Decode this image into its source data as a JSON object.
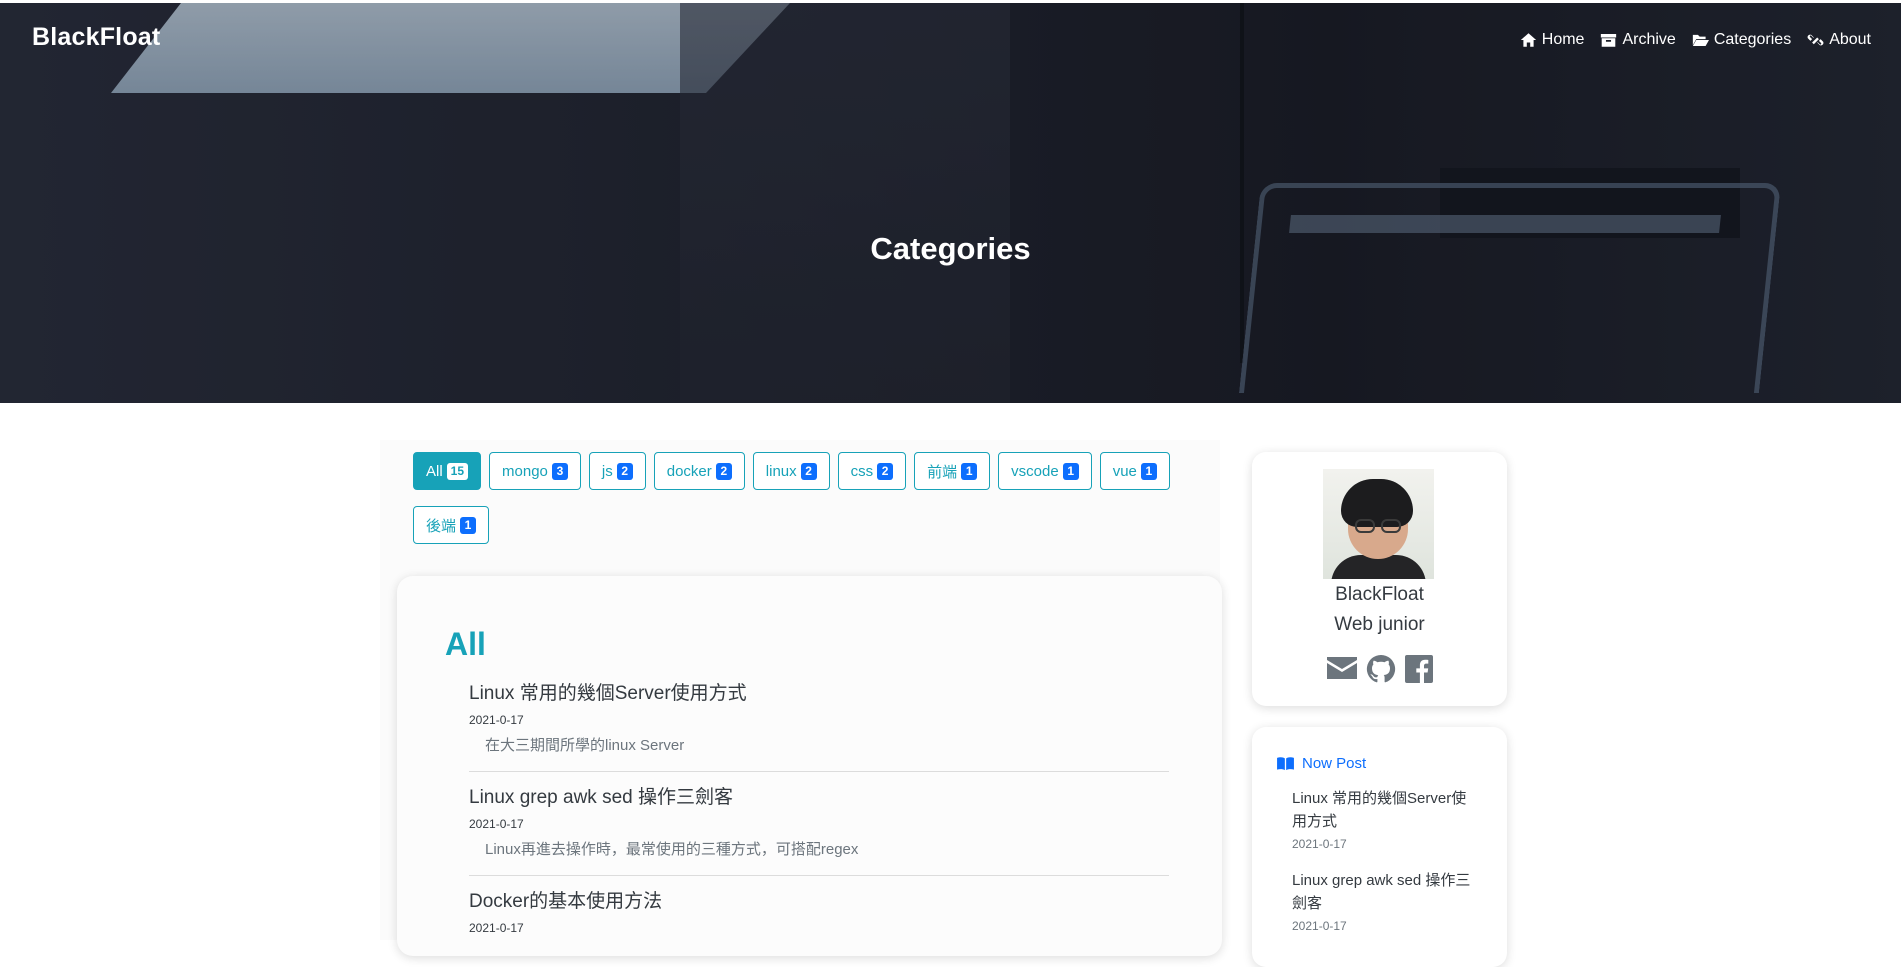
{
  "site": {
    "brand": "BlackFloat",
    "nav": [
      {
        "label": "Home",
        "icon": "home-icon"
      },
      {
        "label": "Archive",
        "icon": "archive-icon"
      },
      {
        "label": "Categories",
        "icon": "folder-open-icon"
      },
      {
        "label": "About",
        "icon": "link-icon"
      }
    ]
  },
  "hero": {
    "title": "Categories"
  },
  "categories": [
    {
      "label": "All",
      "count": "15",
      "active": true
    },
    {
      "label": "mongo",
      "count": "3"
    },
    {
      "label": "js",
      "count": "2"
    },
    {
      "label": "docker",
      "count": "2"
    },
    {
      "label": "linux",
      "count": "2"
    },
    {
      "label": "css",
      "count": "2"
    },
    {
      "label": "前端",
      "count": "1"
    },
    {
      "label": "vscode",
      "count": "1"
    },
    {
      "label": "vue",
      "count": "1"
    },
    {
      "label": "後端",
      "count": "1"
    }
  ],
  "main": {
    "section_title": "All",
    "posts": [
      {
        "title": "Linux 常用的幾個Server使用方式",
        "date": "2021-0-17",
        "desc": "在大三期間所學的linux Server"
      },
      {
        "title": "Linux grep awk sed 操作三劍客",
        "date": "2021-0-17",
        "desc": "Linux再進去操作時，最常使用的三種方式，可搭配regex"
      },
      {
        "title": "Docker的基本使用方法",
        "date": "2021-0-17",
        "desc": ""
      }
    ]
  },
  "profile": {
    "name": "BlackFloat",
    "role": "Web junior",
    "social": [
      "envelope-icon",
      "github-icon",
      "facebook-icon"
    ]
  },
  "now_post": {
    "heading": "Now Post",
    "items": [
      {
        "title": "Linux 常用的幾個Server使用方式",
        "date": "2021-0-17"
      },
      {
        "title": "Linux grep awk sed 操作三劍客",
        "date": "2021-0-17"
      }
    ]
  },
  "colors": {
    "accent": "#17a2b8",
    "badge": "#0d6efd",
    "link": "#0d6efd"
  }
}
